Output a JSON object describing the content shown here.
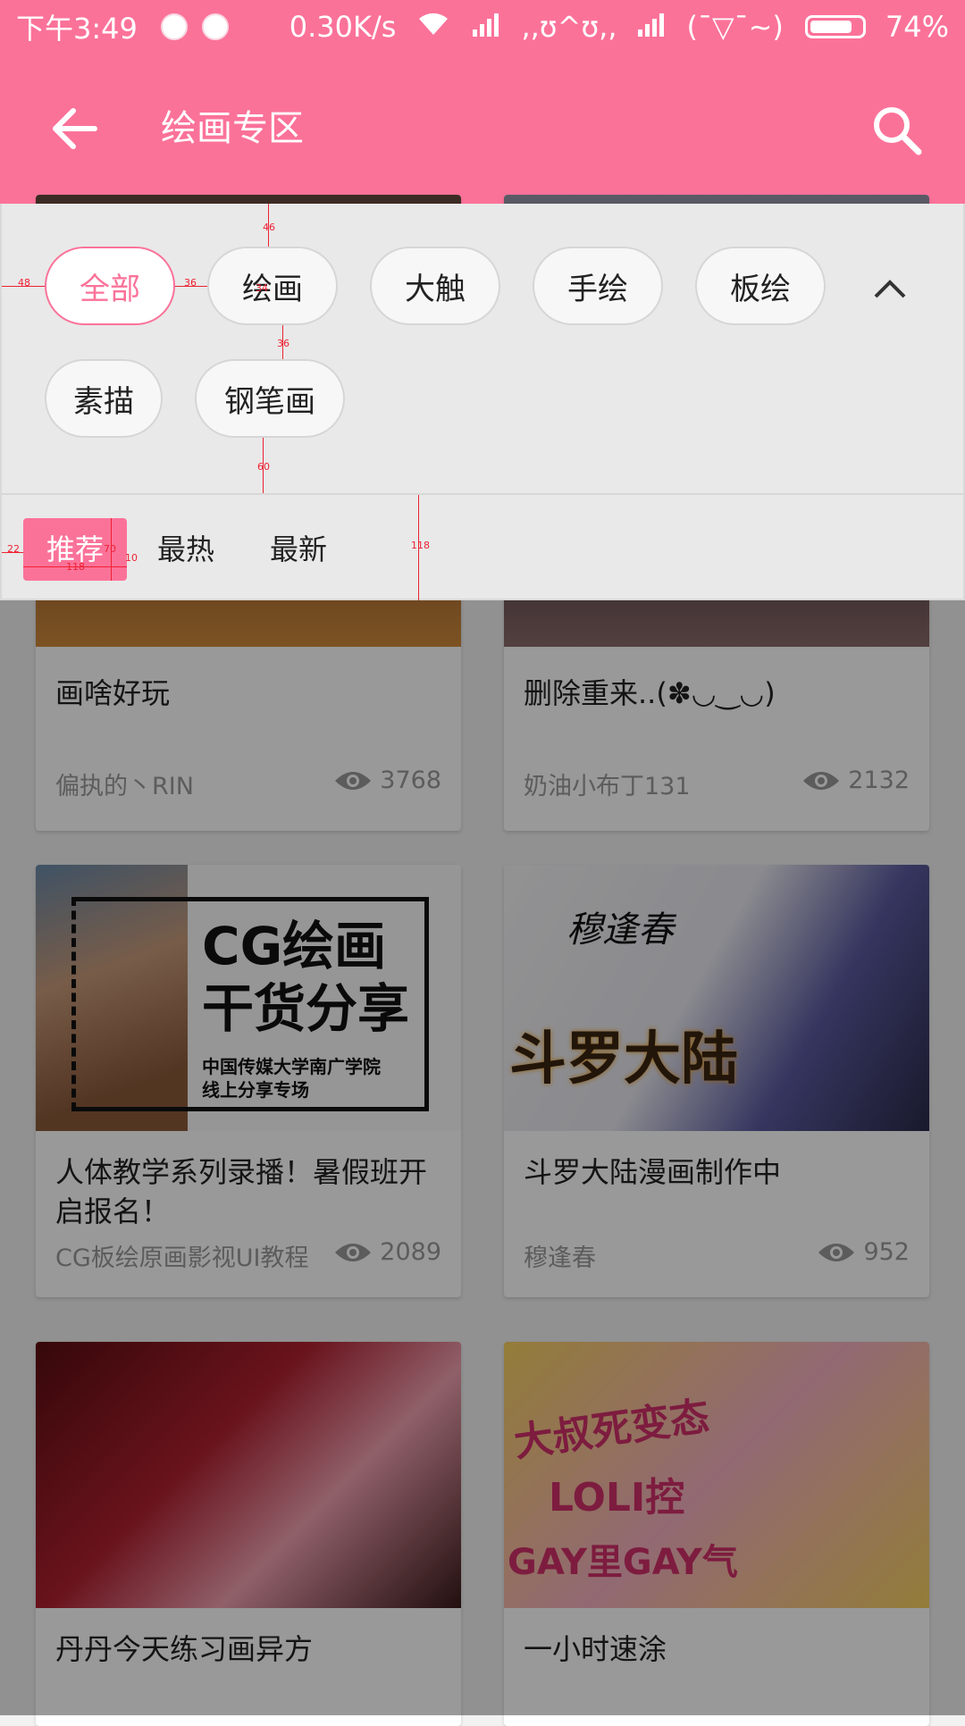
{
  "status_bar": {
    "time": "下午3:49",
    "net_speed": "0.30K/s",
    "carrier": ",,ʊ^ʊ,,",
    "emoticon": "(¯▽¯~)",
    "battery": "74%",
    "battery_level": 0.74
  },
  "toolbar": {
    "title": "绘画专区",
    "back_icon": "arrow-left-icon",
    "search_icon": "search-icon"
  },
  "filter": {
    "chips": [
      "全部",
      "绘画",
      "大触",
      "手绘",
      "板绘",
      "素描",
      "钢笔画"
    ],
    "active_chip": "全部",
    "sort_tabs": [
      "推荐",
      "最热",
      "最新"
    ],
    "active_sort": "推荐",
    "annotations": [
      "48",
      "36",
      "46",
      "36",
      "60",
      "118",
      "22",
      "70",
      "118",
      "10",
      "34"
    ]
  },
  "posts": [
    {
      "title": "画啥好玩",
      "author": "偏执的丶RIN",
      "views": "3768"
    },
    {
      "title": "删除重来..(✽◡‿◡)",
      "author": "奶油小布丁131",
      "views": "2132"
    },
    {
      "title": "人体教学系列录播！暑假班开启报名！",
      "author": "CG板绘原画影视UI教程",
      "views": "2089",
      "image_text": [
        "CG绘画",
        "干货分享",
        "中国传媒大学南广学院",
        "线上分享专场"
      ]
    },
    {
      "title": "斗罗大陆漫画制作中",
      "author": "穆逢春",
      "views": "952",
      "image_text": [
        "穆逢春",
        "斗罗大陆"
      ]
    },
    {
      "title": "丹丹今天练习画异方",
      "author": "",
      "views": ""
    },
    {
      "title": "一小时速涂",
      "author": "",
      "views": "",
      "image_text": [
        "大叔死变态",
        "LOLI控",
        "GAY里GAY气"
      ]
    }
  ],
  "colors": {
    "accent": "#fb7299",
    "panel": "#e9e9e9",
    "measure": "#ee2233"
  }
}
